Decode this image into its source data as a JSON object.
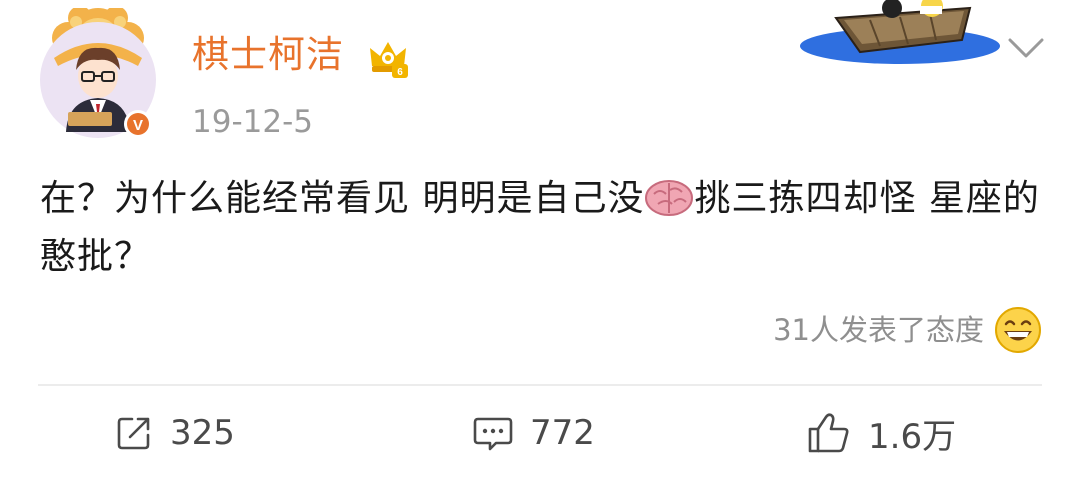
{
  "post": {
    "username": "棋士柯洁",
    "timestamp": "19-12-5",
    "text_before_emoji": "在？为什么能经常看见 明明是自己没",
    "emoji": "brain-emoji",
    "text_after_emoji": "挑三拣四却怪 星座的憨批？",
    "reactions_text": "31人发表了态度"
  },
  "actions": {
    "share_count": "325",
    "comment_count": "772",
    "like_count": "1.6万"
  },
  "colors": {
    "username": "#e8732c",
    "timestamp": "#9a9a9a",
    "verified_badge": "#e8732c",
    "crown": "#f2b400"
  },
  "icons": [
    "avatar",
    "verified-badge-icon",
    "vip-crown-icon",
    "boat-decoration",
    "chevron-down-icon",
    "brain-emoji-icon",
    "grinning-emoji-icon",
    "share-icon",
    "comment-icon",
    "like-icon"
  ]
}
